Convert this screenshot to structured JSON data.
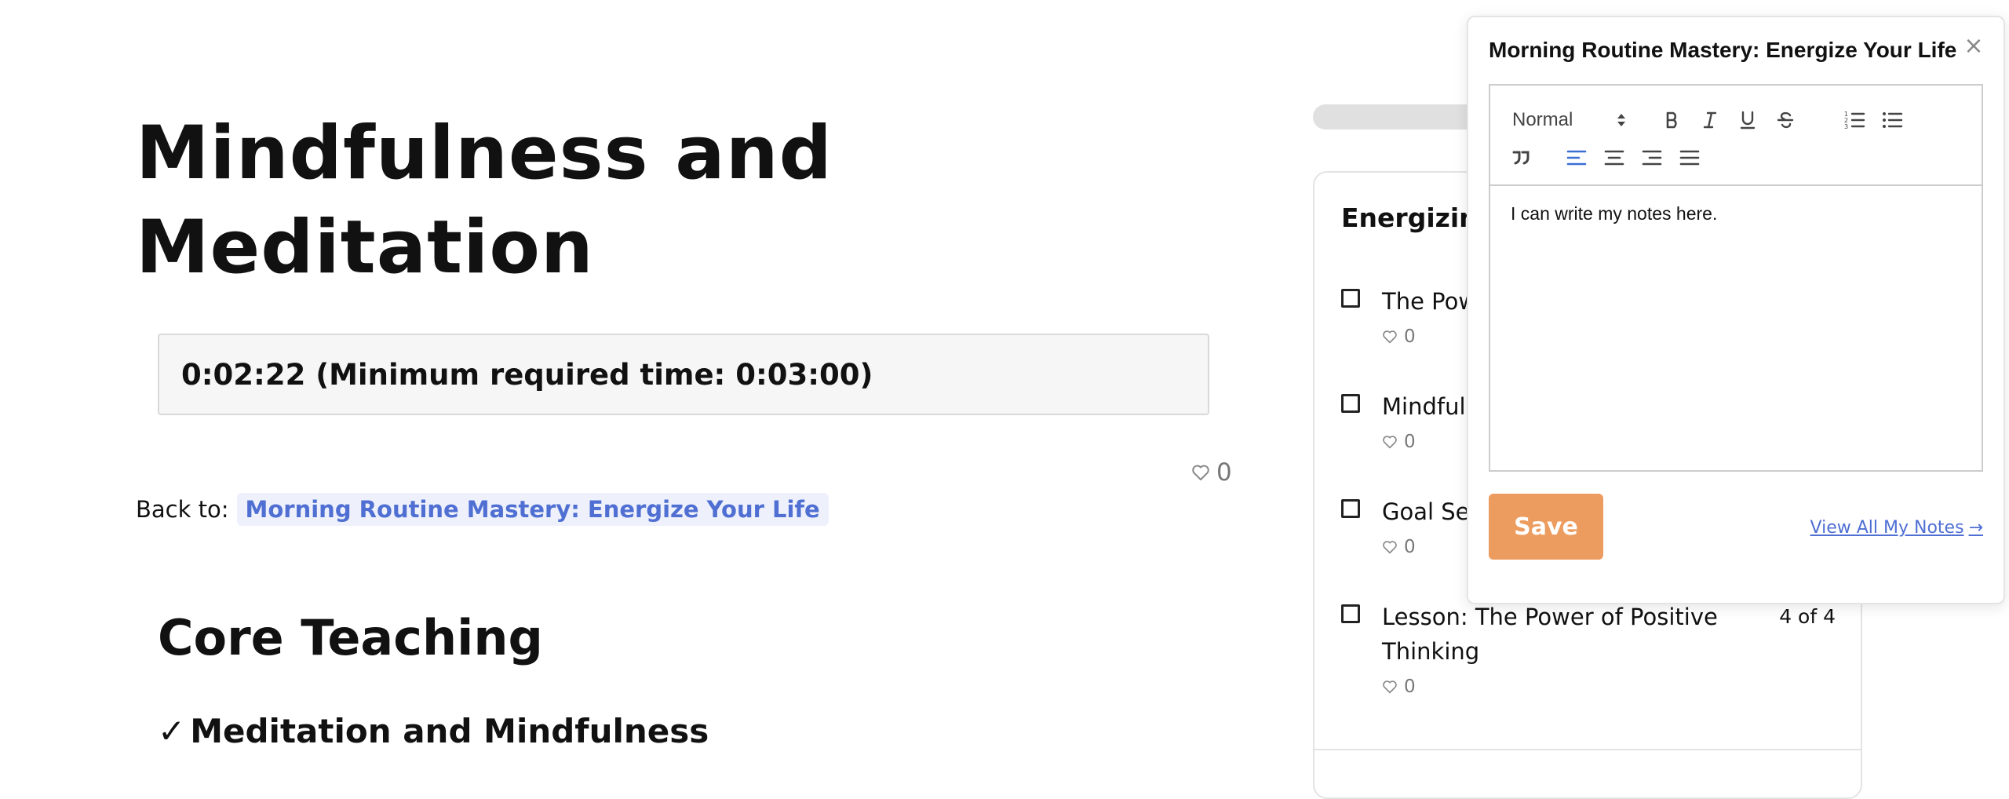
{
  "lesson": {
    "title": "Mindfulness and Meditation",
    "timer_text": "0:02:22 (Minimum required time: 0:03:00)",
    "likes": "0",
    "back_to_label": "Back to:",
    "back_to_link": "Morning Routine Mastery: Energize Your Life",
    "section_heading": "Core Teaching",
    "check_mark": "✓",
    "sub_heading": "Meditation and Mindfulness"
  },
  "sidebar": {
    "panel_title": "Energizing",
    "lessons": [
      {
        "name": "The Pow",
        "likes": "0",
        "count": ""
      },
      {
        "name": "Mindfuln",
        "likes": "0",
        "count": ""
      },
      {
        "name": "Goal Set",
        "likes": "0",
        "count": ""
      },
      {
        "name": "Lesson: The Power of Positive Thinking",
        "likes": "0",
        "count": "4 of 4"
      }
    ]
  },
  "notes": {
    "title": "Morning Routine Mastery: Energize Your Life",
    "close_symbol": "×",
    "format_value": "Normal",
    "content": "I can write my notes here.",
    "save_label": "Save",
    "view_all_label": "View All My Notes",
    "view_all_arrow": "→"
  },
  "colors": {
    "accent_link": "#4f6fd3",
    "save_button": "#ec9c5e",
    "active_align_icon": "#3b6fd4"
  },
  "icons": {
    "heart": "heart-outline-icon",
    "close": "close-icon",
    "bold": "bold-icon",
    "italic": "italic-icon",
    "underline": "underline-icon",
    "strike": "strikethrough-icon",
    "ordered_list": "ordered-list-icon",
    "bullet_list": "bullet-list-icon",
    "quote": "blockquote-icon",
    "align_left": "align-left-icon",
    "align_center": "align-center-icon",
    "align_right": "align-right-icon",
    "align_justify": "align-justify-icon",
    "arrow": "arrow-right-icon"
  }
}
